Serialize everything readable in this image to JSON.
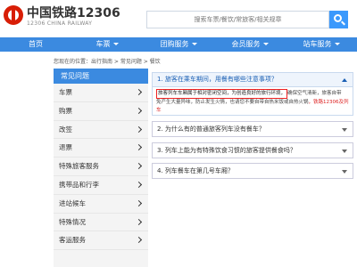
{
  "header": {
    "title": "中国铁路12306",
    "subtitle": "12306 CHINA RAILWAY",
    "search_placeholder": "搜索车票/餐饮/常旅客/相关规章"
  },
  "nav": {
    "items": [
      {
        "label": "首页",
        "has_menu": false
      },
      {
        "label": "车票",
        "has_menu": true
      },
      {
        "label": "团购服务",
        "has_menu": true
      },
      {
        "label": "会员服务",
        "has_menu": true
      },
      {
        "label": "站车服务",
        "has_menu": true
      }
    ]
  },
  "breadcrumb": "您现在的位置：出行指南 > 常见问题 > 餐饮",
  "sidebar": {
    "title": "常见问题",
    "items": [
      "车票",
      "购票",
      "改签",
      "退票",
      "特殊旅客服务",
      "携带品和行李",
      "进站候车",
      "特殊情况",
      "客运服务"
    ]
  },
  "faq": {
    "q1": "1. 旅客在乘车期间，用餐有哪些注意事项？",
    "answer_line1_highlight": "旅客列车车厢属于相对密闭空间，为创造良好的旅行环境，",
    "answer_line1_rest": "确保空气清新，旅客自带",
    "answer_line2_part1": "免产生大量异味，防止发生火情，也请您不要自带自热米饭或自热火锅",
    "answer_line2_red": "，铁路12306及列车",
    "q2": "2. 为什么有的普通旅客列车没有餐车？",
    "q3": "3. 列车上能为有特殊饮食习惯的旅客提供餐食吗？",
    "q4": "4. 列车餐车在第几号车厢？"
  },
  "colors": {
    "brand_blue": "#3b8ae0",
    "logo_red": "#d81e06",
    "highlight_border": "#e22"
  }
}
